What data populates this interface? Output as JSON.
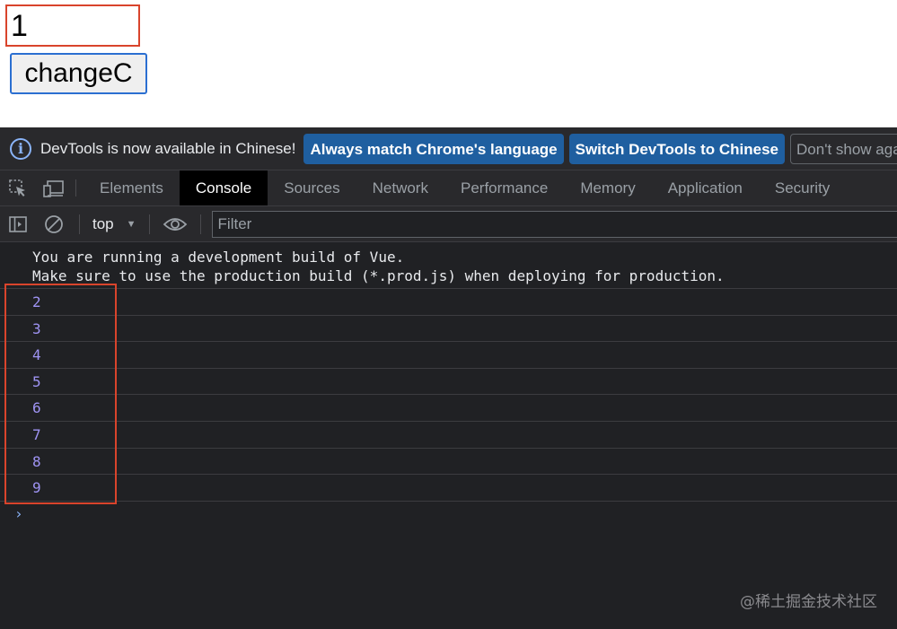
{
  "page": {
    "counter_value": "1",
    "button_label": "changeC"
  },
  "devtools": {
    "infobar": {
      "message": "DevTools is now available in Chinese!",
      "buttons": {
        "always_match": "Always match Chrome's language",
        "switch": "Switch DevTools to Chinese",
        "dont_show": "Don't show again"
      }
    },
    "tabs": {
      "elements": "Elements",
      "console": "Console",
      "sources": "Sources",
      "network": "Network",
      "performance": "Performance",
      "memory": "Memory",
      "application": "Application",
      "security": "Security"
    },
    "console_toolbar": {
      "context": "top",
      "filter_placeholder": "Filter"
    },
    "console": {
      "vue_warning": "You are running a development build of Vue.\nMake sure to use the production build (*.prod.js) when deploying for production.",
      "logs": [
        "2",
        "3",
        "4",
        "5",
        "6",
        "7",
        "8",
        "9"
      ],
      "prompt_symbol": "›"
    },
    "watermark": "@稀土掘金技术社区"
  },
  "colors": {
    "highlight_border": "#d9442c",
    "button_border": "#2b6fd1",
    "log_number": "#9f94f4",
    "devtools_bg": "#202124",
    "primary_button_bg": "#1f5fa0"
  }
}
